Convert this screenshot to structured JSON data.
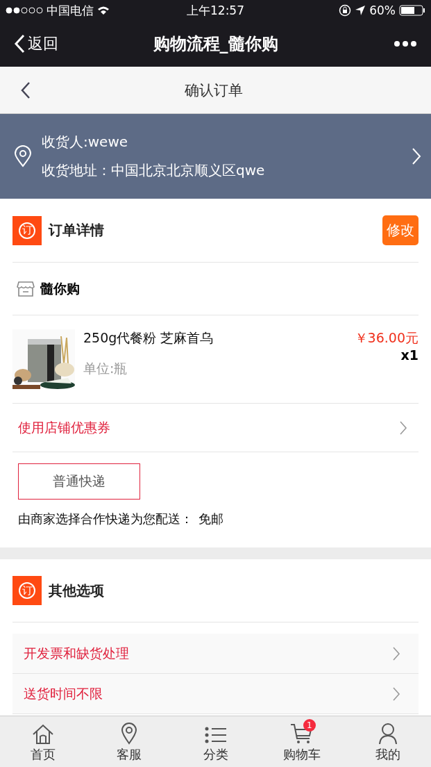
{
  "status_bar": {
    "carrier": "中国电信",
    "time": "上午12:57",
    "battery": "60%"
  },
  "nav_bar": {
    "back": "返回",
    "title": "购物流程_髓你购"
  },
  "header": {
    "title": "确认订单"
  },
  "address": {
    "recipient": "收货人:wewe",
    "address": "收货地址：中国北京北京顺义区qwe"
  },
  "order": {
    "icon": "订",
    "title": "订单详情",
    "edit": "修改",
    "store": "髓你购",
    "item": {
      "name": "250g代餐粉 芝麻首乌",
      "unit": "单位:瓶",
      "price": "￥36.00元",
      "qty": "x1"
    },
    "coupon": "使用店铺优惠券",
    "shipping": {
      "option": "普通快递",
      "note": "由商家选择合作快递为您配送：",
      "fee": "免邮"
    }
  },
  "options": {
    "icon": "订",
    "title": "其他选项",
    "rows": [
      "开发票和缺货处理",
      "送货时间不限"
    ]
  },
  "tab_bar": [
    {
      "label": "首页",
      "kind": "home"
    },
    {
      "label": "客服",
      "kind": "pin"
    },
    {
      "label": "分类",
      "kind": "list"
    },
    {
      "label": "购物车",
      "kind": "cart",
      "badge": "1"
    },
    {
      "label": "我的",
      "kind": "user"
    }
  ]
}
